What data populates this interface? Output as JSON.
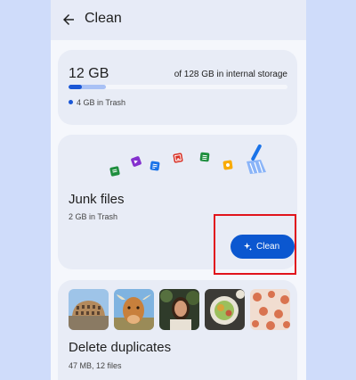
{
  "appbar": {
    "title": "Clean"
  },
  "storage": {
    "used": "12 GB",
    "total_text": "of 128 GB in internal storage",
    "usage_fraction": 0.17,
    "trash_fraction": 0.06,
    "trash_text": "4 GB in Trash"
  },
  "junk": {
    "title": "Junk files",
    "subtitle": "2 GB in Trash",
    "button_label": "Clean"
  },
  "duplicates": {
    "title": "Delete duplicates",
    "subtitle": "47 MB, 12 files"
  },
  "colors": {
    "accent": "#0b57d0",
    "highlight": "#e1141c",
    "background": "#cfdcfa"
  }
}
